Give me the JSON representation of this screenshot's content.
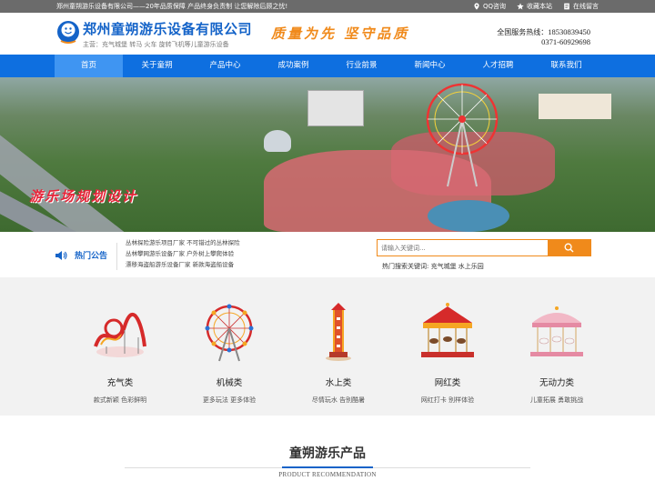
{
  "topbar": {
    "notice": "郑州童朔游乐设备有限公司——20年品质保障 产品终身负责制 让您解除后顾之忧!",
    "links": [
      {
        "label": "QQ咨询",
        "icon": "location-icon"
      },
      {
        "label": "收藏本站",
        "icon": "star-icon"
      },
      {
        "label": "在线留言",
        "icon": "document-icon"
      }
    ]
  },
  "header": {
    "company_name": "郑州童朔游乐设备有限公司",
    "subtitle": "主营：充气城堡 转马 火车 旋转飞机等儿童游乐设备",
    "slogan": "质量为先  坚守品质",
    "hotline_label": "全国服务热线：",
    "phone_1": "18530839450",
    "phone_2": "0371-60929698"
  },
  "nav": {
    "items": [
      "首页",
      "关于童朔",
      "产品中心",
      "成功案例",
      "行业前景",
      "新闻中心",
      "人才招聘",
      "联系我们"
    ],
    "active_index": 0
  },
  "banner": {
    "title": "游乐场规划设计"
  },
  "announcement": {
    "title": "热门公告",
    "items": [
      "丛林探险游乐项目厂家 不可错过的丛林探险",
      "丛林攀网游乐设备厂家 户外树上攀爬体验",
      "漂移海盗船游乐设备厂家 新款海盗船设备"
    ]
  },
  "search": {
    "placeholder": "请输入关键词...",
    "hot_keywords": "热门搜索关键词: 充气城堡 水上乐园"
  },
  "categories": [
    {
      "name": "充气类",
      "desc": "款式新颖 色彩鲜明",
      "icon": "roller-coaster-icon"
    },
    {
      "name": "机械类",
      "desc": "更多玩法 更多体验",
      "icon": "ferris-wheel-icon"
    },
    {
      "name": "水上类",
      "desc": "尽情玩水 告别酷暑",
      "icon": "tower-ride-icon"
    },
    {
      "name": "网红类",
      "desc": "网红打卡 别样体验",
      "icon": "carousel-icon"
    },
    {
      "name": "无动力类",
      "desc": "儿童拓展 勇敢挑战",
      "icon": "carousel-small-icon"
    }
  ],
  "products": {
    "title": "童朔游乐产品",
    "subtitle": "PRODUCT RECOMMENDATION"
  },
  "colors": {
    "brand_blue": "#1463c8",
    "nav_blue": "#0e6fe0",
    "accent_orange": "#f08a1b",
    "banner_title_red": "#e8253a"
  }
}
